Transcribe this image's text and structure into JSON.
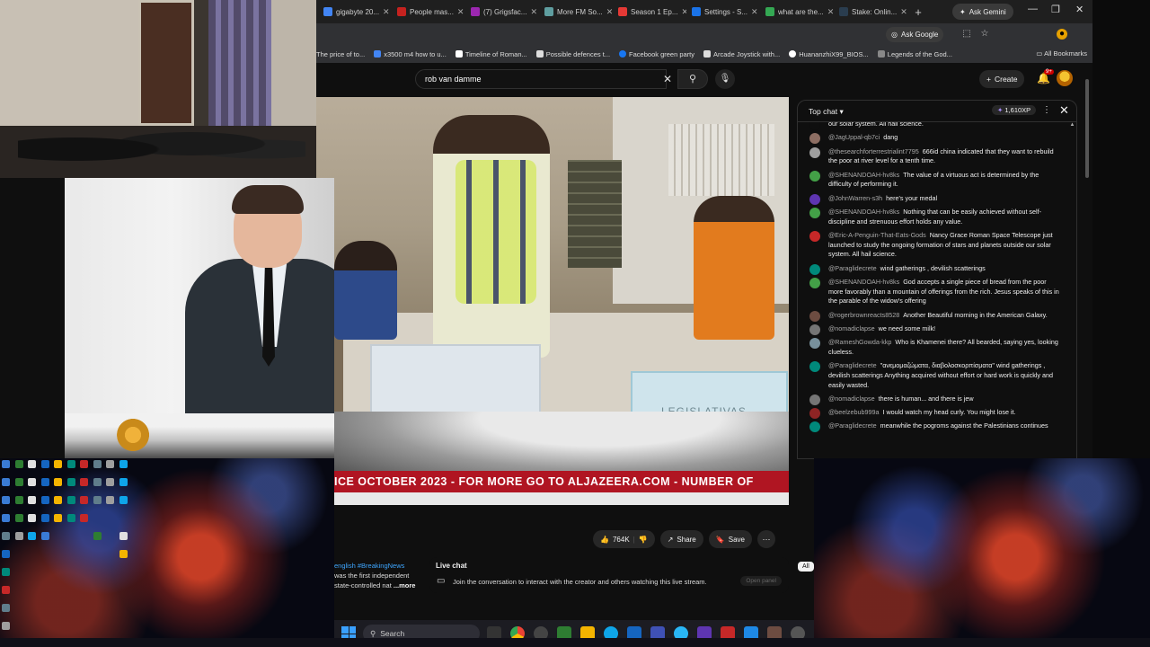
{
  "browser": {
    "tabs": [
      {
        "label": "gigabyte 20...",
        "color": "#4285f4"
      },
      {
        "label": "People mas...",
        "color": "#c5221f"
      },
      {
        "label": "(7) Grigsfac...",
        "color": "#9c27b0"
      },
      {
        "label": "More FM So...",
        "color": "#5f9ea0"
      },
      {
        "label": "Season 1 Ep...",
        "color": "#e53935"
      },
      {
        "label": "Settings - S...",
        "color": "#1a73e8"
      },
      {
        "label": "what are the...",
        "color": "#34a853"
      },
      {
        "label": "Stake: Onlin...",
        "color": "#2a3d4f"
      }
    ],
    "new_tab": "+",
    "ask_gemini": "Ask Gemini",
    "ask_google": "Ask Google",
    "bookmarks": [
      {
        "label": "The price of to...",
        "color": "#999"
      },
      {
        "label": "x3500 m4 how to u...",
        "color": "#4285f4"
      },
      {
        "label": "Timeline of Roman...",
        "color": "#fff"
      },
      {
        "label": "Possible defences t...",
        "color": "#ddd"
      },
      {
        "label": "Facebook green party",
        "color": "#1877f2"
      },
      {
        "label": "Arcade Joystick with...",
        "color": "#ddd"
      },
      {
        "label": "HuananzhiX99_BIOS...",
        "color": "#fff"
      },
      {
        "label": "Legends of the God...",
        "color": "#888"
      }
    ],
    "all_bookmarks": "All Bookmarks"
  },
  "youtube": {
    "search_value": "rob van damme",
    "create_label": "Create",
    "notifications_badge": "9+",
    "video_ticker": "ICE OCTOBER 2023   -   FOR MORE GO TO ALJAZEERA.COM   -   NUMBER OF",
    "ballot_box_text": "LEGISLATIVAS",
    "likes": "764K",
    "share_label": "Share",
    "save_label": "Save",
    "description": {
      "tag": "english #BreakingNews",
      "line2": "was the first independent",
      "line3": "state-controlled nat",
      "more": "...more"
    },
    "live_chat_box": {
      "title": "Live chat",
      "text": "Join the conversation to interact with the creator and others watching this live stream.",
      "open_panel": "Open panel"
    },
    "all_chip": "All"
  },
  "chat": {
    "title": "Top chat",
    "xp": "1,610XP",
    "messages": [
      {
        "author": "",
        "text": "our solar system. All hail science.",
        "color": "#0f0f0f"
      },
      {
        "author": "@JagUppal-qb7ci",
        "text": "dang",
        "color": "#8d6e63"
      },
      {
        "author": "@thesearchforterrestrialint7795",
        "text": "666id china indicated that they want to rebuild the poor at river level for a tenth time.",
        "color": "#9e9e9e"
      },
      {
        "author": "@SHENANDOAH-hv8ks",
        "text": "The value of a virtuous act is determined by the difficulty of performing it.",
        "color": "#43a047"
      },
      {
        "author": "@JohnWarren-s3h",
        "text": "here's your medal",
        "color": "#5e35b1"
      },
      {
        "author": "@SHENANDOAH-hv8ks",
        "text": "Nothing that can be easily achieved without self-discipline and strenuous effort holds any value.",
        "color": "#43a047"
      },
      {
        "author": "@Eric-A-Penguin-That-Eats-Gods",
        "text": "Nancy Grace Roman Space Telescope just launched to study the ongoing formation of stars and planets outside our solar system. All hail science.",
        "color": "#c62828"
      },
      {
        "author": "@Paraglidecrete",
        "text": "wind gatherings , devilish scatterings",
        "color": "#00897b"
      },
      {
        "author": "@SHENANDOAH-hv8ks",
        "text": "God accepts a single piece of bread from the poor more favorably than a mountain of offerings from the rich. Jesus speaks of this in the parable of the widow's offering",
        "color": "#43a047"
      },
      {
        "author": "@rogerbrownreacts8528",
        "text": "Another Beautiful morning in the American Galaxy.",
        "color": "#6d4c41"
      },
      {
        "author": "@nomadiclapse",
        "text": "we need some milk!",
        "color": "#757575"
      },
      {
        "author": "@RameshGowda-kkp",
        "text": "Who is Khamenei there? All bearded, saying yes, looking clueless.",
        "color": "#78909c"
      },
      {
        "author": "@Paraglidecrete",
        "text": "\"ανεμομαζώματα, διαβολοσκορπίσματα\" wind gatherings , devilish scatterings Anything acquired without effort or hard work is quickly and easily wasted.",
        "color": "#00897b"
      },
      {
        "author": "@nomadiclapse",
        "text": "there is human... and there is jew",
        "color": "#757575"
      },
      {
        "author": "@beelzebub999a",
        "text": "I would watch my head curly. You might lose it.",
        "color": "#8e2424"
      },
      {
        "author": "@Paraglidecrete",
        "text": "meanwhile the pogroms against the Palestinians continues",
        "color": "#00897b"
      }
    ]
  },
  "taskbar": {
    "search_label": "Search"
  }
}
